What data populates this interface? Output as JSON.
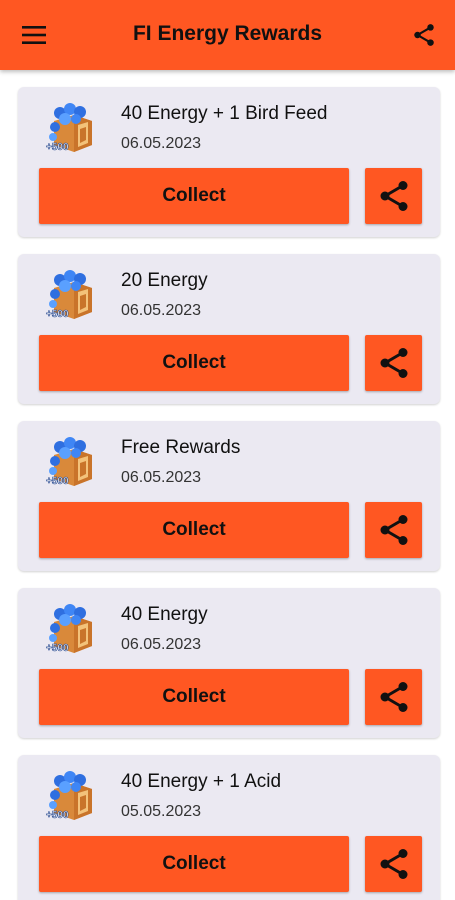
{
  "app": {
    "title": "FI Energy Rewards",
    "menu_icon": "hamburger-menu-icon",
    "share_icon": "share-icon",
    "accent_color": "#ff5722",
    "card_color": "#ebe9f2"
  },
  "rewards": [
    {
      "name": "40 Energy + 1 Bird Feed",
      "date": "06.05.2023",
      "button": "Collect",
      "thumb_badge": "+500"
    },
    {
      "name": "20 Energy",
      "date": "06.05.2023",
      "button": "Collect",
      "thumb_badge": "+500"
    },
    {
      "name": "Free Rewards",
      "date": "06.05.2023",
      "button": "Collect",
      "thumb_badge": "+500"
    },
    {
      "name": "40 Energy",
      "date": "06.05.2023",
      "button": "Collect",
      "thumb_badge": "+500"
    },
    {
      "name": "40 Energy + 1 Acid",
      "date": "05.05.2023",
      "button": "Collect",
      "thumb_badge": "+500"
    }
  ]
}
